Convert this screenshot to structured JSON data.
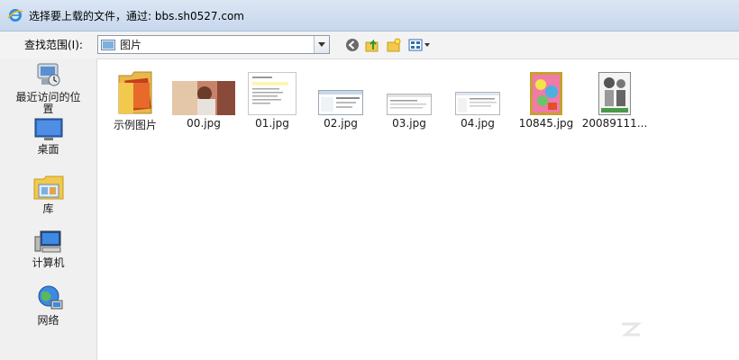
{
  "window": {
    "title": "选择要上载的文件，通过: bbs.sh0527.com",
    "icon": "ie-icon"
  },
  "toolbar": {
    "lookin_label": "查找范围(I):",
    "lookin_value": "图片",
    "buttons": [
      "back-icon",
      "up-folder-icon",
      "new-folder-icon",
      "view-menu-icon"
    ]
  },
  "places": [
    {
      "label": "最近访问的位置",
      "icon": "recent-places-icon"
    },
    {
      "label": "桌面",
      "icon": "desktop-icon"
    },
    {
      "label": "库",
      "icon": "libraries-icon"
    },
    {
      "label": "计算机",
      "icon": "computer-icon"
    },
    {
      "label": "网络",
      "icon": "network-icon"
    }
  ],
  "files": [
    {
      "name": "示例图片",
      "kind": "folder"
    },
    {
      "name": "00.jpg",
      "kind": "photo"
    },
    {
      "name": "01.jpg",
      "kind": "document"
    },
    {
      "name": "02.jpg",
      "kind": "screenshot"
    },
    {
      "name": "03.jpg",
      "kind": "screenshot"
    },
    {
      "name": "04.jpg",
      "kind": "screenshot"
    },
    {
      "name": "10845.jpg",
      "kind": "painting"
    },
    {
      "name": "20089111...",
      "kind": "sketch"
    }
  ],
  "colors": {
    "title_bar": "#c7d7ec",
    "pane_bg": "#ffffff",
    "places_bg": "#f0f0f0",
    "folder": "#f2c94c"
  }
}
